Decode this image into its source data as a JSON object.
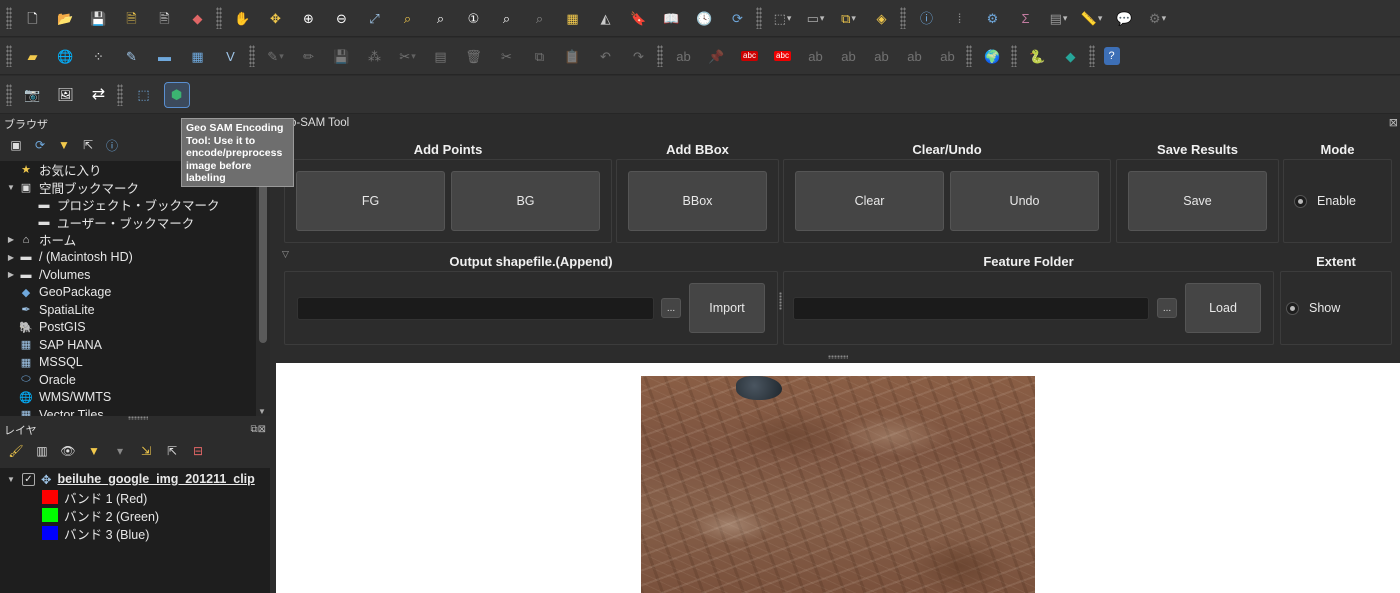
{
  "toolbar1": {
    "icons": [
      "new-project-icon",
      "open-project-icon",
      "save-project-icon",
      "save-as-icon",
      "print-layout-icon",
      "style-manager-icon",
      "pan-hand-icon",
      "pan-to-selection-icon",
      "zoom-in-icon",
      "zoom-out-icon",
      "zoom-full-icon",
      "zoom-to-selection-icon",
      "zoom-to-layer-icon",
      "zoom-native-icon",
      "zoom-last-icon",
      "zoom-next-icon",
      "new-map-view-icon",
      "new-3d-view-icon",
      "new-bookmark-icon",
      "show-bookmarks-icon",
      "temporal-controller-icon",
      "refresh-icon",
      "select-features-icon",
      "deselect-icon",
      "select-by-value-icon",
      "identify-icon",
      "attribute-table-icon",
      "field-calculator-icon",
      "statistics-icon",
      "open-table-icon",
      "measure-icon",
      "annotation-icon",
      "settings-icon"
    ]
  },
  "toolbar2": {
    "icons": [
      "data-source-manager-icon",
      "add-layer-icon",
      "new-shapefile-icon",
      "digitize-icon",
      "toggle-editing-icon",
      "save-edits-icon",
      "add-feature-icon",
      "vertex-tool-icon",
      "delete-selected-icon",
      "cut-features-icon",
      "copy-features-icon",
      "paste-features-icon",
      "undo-icon",
      "redo-icon",
      "label-tool-icon",
      "pin-label-icon",
      "highlight-label-icon",
      "python-console-icon",
      "plugin-icon",
      "help-icon"
    ],
    "label_badge_1": "abc",
    "label_badge_2": "abc"
  },
  "toolbar3": {
    "icons": [
      "screenshot-icon",
      "image-layer-icon",
      "swap-icon",
      "geo-sam-select-icon",
      "geo-sam-encoding-icon"
    ]
  },
  "tooltip": {
    "text": "Geo SAM Encoding Tool: Use it to encode/preprocess image before labeling"
  },
  "browser": {
    "title": "ブラウザ",
    "items": [
      {
        "label": "お気に入り",
        "icon": "star-icon",
        "arrow": "",
        "indent": 0
      },
      {
        "label": "空間ブックマーク",
        "icon": "bookmark-icon",
        "arrow": "▼",
        "indent": 0
      },
      {
        "label": "プロジェクト・ブックマーク",
        "icon": "folder-icon",
        "arrow": "",
        "indent": 1
      },
      {
        "label": "ユーザー・ブックマーク",
        "icon": "folder-icon",
        "arrow": "",
        "indent": 1
      },
      {
        "label": "ホーム",
        "icon": "home-icon",
        "arrow": "▶",
        "indent": 0
      },
      {
        "label": "/ (Macintosh HD)",
        "icon": "folder-icon",
        "arrow": "▶",
        "indent": 0
      },
      {
        "label": "/Volumes",
        "icon": "folder-icon",
        "arrow": "▶",
        "indent": 0
      },
      {
        "label": "GeoPackage",
        "icon": "geopackage-icon",
        "arrow": "",
        "indent": 0
      },
      {
        "label": "SpatiaLite",
        "icon": "spatialite-icon",
        "arrow": "",
        "indent": 0
      },
      {
        "label": "PostGIS",
        "icon": "postgis-icon",
        "arrow": "",
        "indent": 0
      },
      {
        "label": "SAP HANA",
        "icon": "sap-hana-icon",
        "arrow": "",
        "indent": 0
      },
      {
        "label": "MSSQL",
        "icon": "mssql-icon",
        "arrow": "",
        "indent": 0
      },
      {
        "label": "Oracle",
        "icon": "oracle-icon",
        "arrow": "",
        "indent": 0
      },
      {
        "label": "WMS/WMTS",
        "icon": "wms-icon",
        "arrow": "",
        "indent": 0
      },
      {
        "label": "Vector Tiles",
        "icon": "vector-tiles-icon",
        "arrow": "",
        "indent": 0
      }
    ]
  },
  "layers": {
    "title": "レイヤ",
    "layer_name": "beiluhe_google_img_201211_clip",
    "bands": [
      {
        "label": "バンド 1 (Red)",
        "color": "#ff0000"
      },
      {
        "label": "バンド 2 (Green)",
        "color": "#00ff00"
      },
      {
        "label": "バンド 3 (Blue)",
        "color": "#0000ff"
      }
    ]
  },
  "plugin": {
    "title": "o-SAM Tool",
    "add_points_title": "Add Points",
    "fg_label": "FG",
    "bg_label": "BG",
    "add_bbox_title": "Add BBox",
    "bbox_label": "BBox",
    "clear_undo_title": "Clear/Undo",
    "clear_label": "Clear",
    "undo_label": "Undo",
    "save_results_title": "Save Results",
    "save_label": "Save",
    "mode_title": "Mode",
    "enable_label": "Enable",
    "output_title": "Output shapefile.(Append)",
    "browse_label": "...",
    "import_label": "Import",
    "feature_folder_title": "Feature Folder",
    "load_label": "Load",
    "extent_title": "Extent",
    "show_label": "Show"
  },
  "colors": {
    "accent": "#5a8fd0",
    "panel_bg": "#2c2c2c",
    "tree_bg": "#1e1e1e",
    "button_bg": "#454545"
  }
}
